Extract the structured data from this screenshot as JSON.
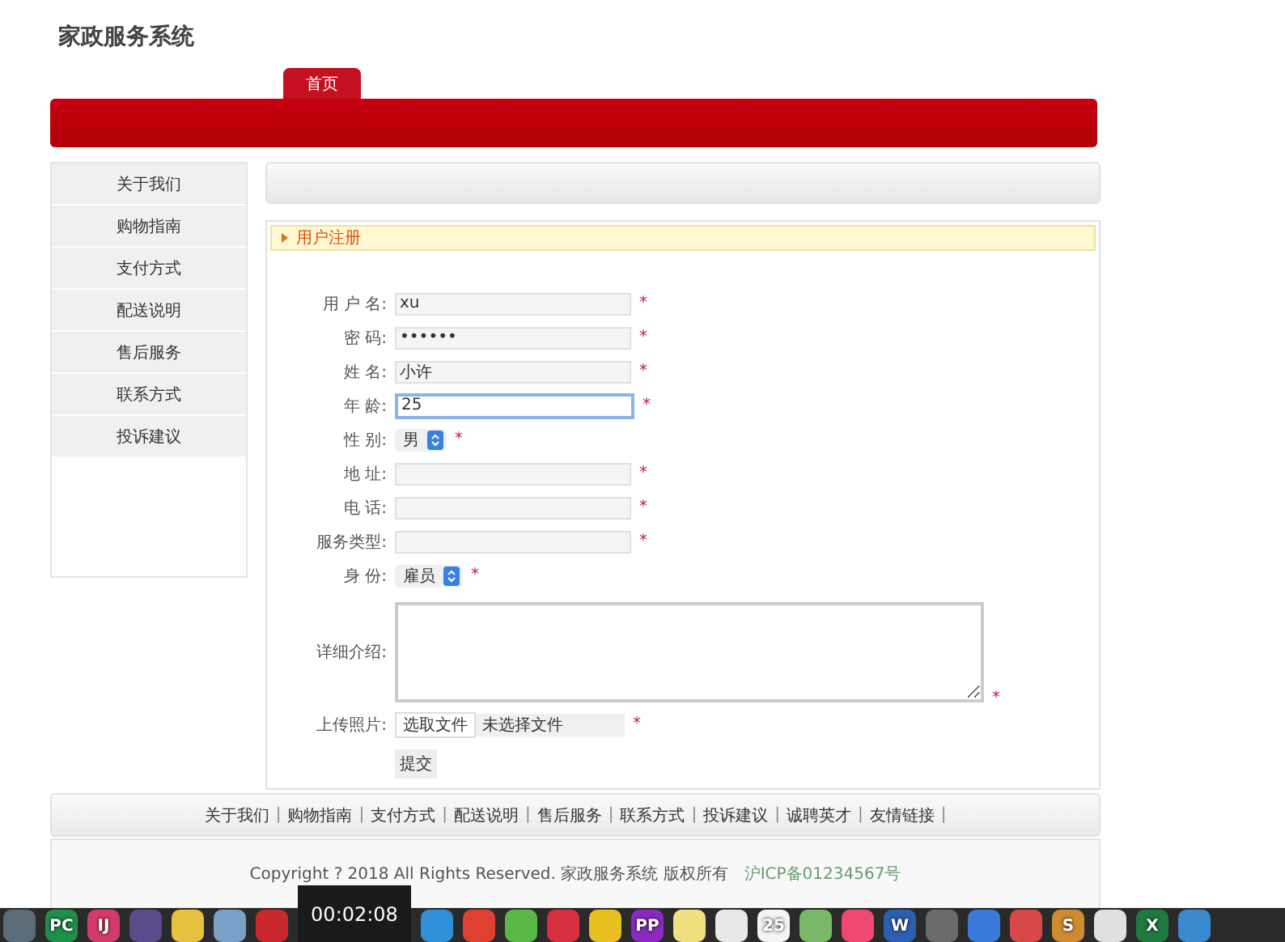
{
  "site_title": "家政服务系统",
  "nav_tabs": [
    {
      "label": "首页",
      "selected": true
    }
  ],
  "sidebar": {
    "items": [
      {
        "label": "关于我们"
      },
      {
        "label": "购物指南"
      },
      {
        "label": "支付方式"
      },
      {
        "label": "配送说明"
      },
      {
        "label": "售后服务"
      },
      {
        "label": "联系方式"
      },
      {
        "label": "投诉建议"
      }
    ]
  },
  "form": {
    "title": "用户注册",
    "fields": [
      {
        "kind": "text",
        "label": "用 户 名:",
        "value": "xu",
        "marker": "*",
        "focused": false
      },
      {
        "kind": "text",
        "label": "密 码:",
        "value": "••••••",
        "marker": "*",
        "focused": false
      },
      {
        "kind": "text",
        "label": "姓 名:",
        "value": "小许",
        "marker": "*",
        "focused": false
      },
      {
        "kind": "text",
        "label": "年 龄:",
        "value": "25",
        "marker": "*",
        "focused": true
      },
      {
        "kind": "select",
        "label": "性 别:",
        "value": "男",
        "marker": "*"
      },
      {
        "kind": "text",
        "label": "地 址:",
        "marker": "*",
        "focused": false
      },
      {
        "kind": "text",
        "label": "电 话:",
        "marker": "*",
        "focused": false
      },
      {
        "kind": "text",
        "label": "服务类型:",
        "marker": "*",
        "focused": false
      },
      {
        "kind": "select",
        "label": "身 份:",
        "value": "雇员",
        "marker": "*"
      },
      {
        "kind": "textarea",
        "label": "详细介绍:",
        "marker": "*"
      },
      {
        "kind": "file",
        "label": "上传照片:",
        "button": "选取文件",
        "value": "未选择文件",
        "marker": "*"
      }
    ],
    "submit": "提交"
  },
  "footer_links": [
    {
      "label": "关于我们",
      "separator": "|"
    },
    {
      "label": "购物指南",
      "separator": "|"
    },
    {
      "label": "支付方式",
      "separator": "|"
    },
    {
      "label": "配送说明",
      "separator": "|"
    },
    {
      "label": "售后服务",
      "separator": "|"
    },
    {
      "label": "联系方式",
      "separator": "|"
    },
    {
      "label": "投诉建议",
      "separator": "|"
    },
    {
      "label": "诚聘英才",
      "separator": "|"
    },
    {
      "label": "友情链接",
      "separator": "|"
    }
  ],
  "copyright": {
    "text": "Copyright ? 2018 All Rights Reserved. 家政服务系统 版权所有",
    "icp": "沪ICP备01234567号"
  },
  "video_time": "00:02:08",
  "dock": [
    {
      "color": "#5a6b7a"
    },
    {
      "color": "#1f8f4a",
      "label": "PC"
    },
    {
      "color": "#d23a6a",
      "label": "IJ"
    },
    {
      "color": "#5b4a8c"
    },
    {
      "color": "#e8c040"
    },
    {
      "color": "#7aa0c8"
    },
    {
      "color": "#c8282c"
    },
    {
      "color": "#2f8fd8"
    },
    {
      "color": "#e04030"
    },
    {
      "color": "#58b848"
    },
    {
      "color": "#d83040"
    },
    {
      "color": "#e8c020"
    },
    {
      "color": "#8a2ac0",
      "label": "PP"
    },
    {
      "color": "#f0e080"
    },
    {
      "color": "#e8e8e8"
    },
    {
      "color": "#f4f4f4",
      "label": "25"
    },
    {
      "color": "#78b868"
    },
    {
      "color": "#f04870"
    },
    {
      "color": "#2b5fb0",
      "label": "W"
    },
    {
      "color": "#6a6a6a"
    },
    {
      "color": "#3a7ad8"
    },
    {
      "color": "#d84848"
    },
    {
      "color": "#d08a30",
      "label": "S"
    },
    {
      "color": "#e0e0e0"
    },
    {
      "color": "#1f7a40",
      "label": "X"
    },
    {
      "color": "#3a8ad0"
    }
  ]
}
